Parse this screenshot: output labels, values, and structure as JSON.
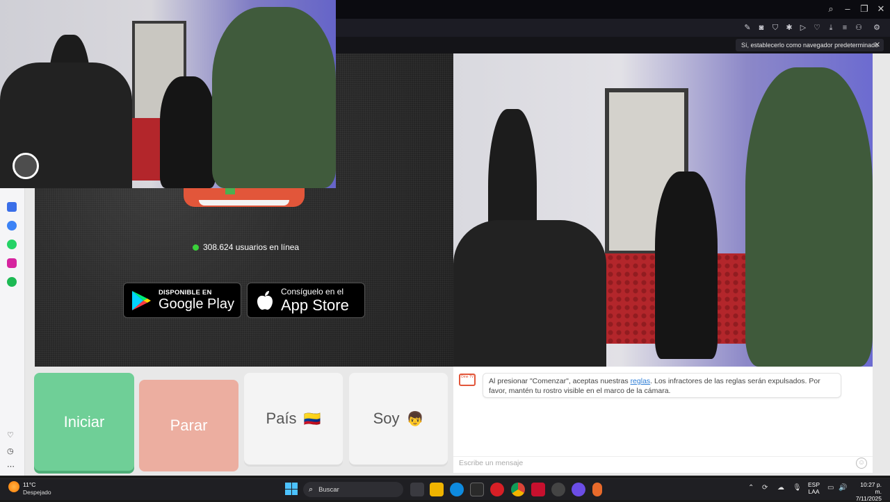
{
  "browser": {
    "default_browser_prompt": "Sí, establecerlo como navegador predeterminado"
  },
  "page": {
    "users_online": "308.624 usuarios en línea",
    "google_play": {
      "top": "DISPONIBLE EN",
      "bottom": "Google Play"
    },
    "app_store": {
      "top": "Consíguelo en el",
      "bottom": "App Store"
    },
    "buttons": {
      "start": "Iniciar",
      "stop": "Parar",
      "country": "País",
      "country_flag": "🇨🇴",
      "gender": "Soy",
      "gender_emoji": "👦"
    },
    "chat": {
      "message_prefix": "Al presionar \"Comenzar\", aceptas nuestras ",
      "message_link": "reglas",
      "message_suffix": ". Los infractores de las reglas serán expulsados. Por favor, mantén tu rostro visible en el marco de la cámara.",
      "input_placeholder": "Escribe un mensaje",
      "badge": "Ome TV"
    }
  },
  "taskbar": {
    "weather_temp": "11°C",
    "weather_desc": "Despejado",
    "search_label": "Buscar",
    "lang_top": "ESP",
    "lang_bottom": "LAA",
    "time": "10:27 p. m.",
    "date": "7/11/2025"
  },
  "colors": {
    "start_green": "#6fcf97",
    "stop_salmon": "#ecaea0",
    "online_dot": "#3ad03a"
  }
}
